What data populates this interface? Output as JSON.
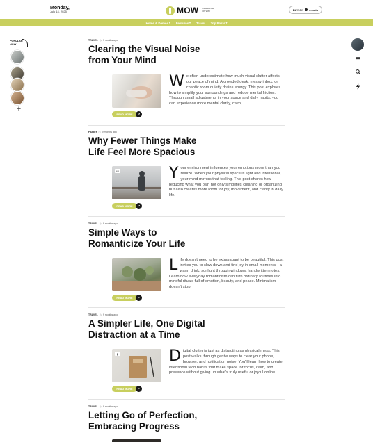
{
  "header": {
    "day": "Monday,",
    "date": "July 14, 2025",
    "logo": "MOW",
    "logo_tagline": "MINIMALISM ON WAY",
    "buy_label": "BUY ON",
    "buy_brand": "envato"
  },
  "nav": [
    {
      "label": "Home & Demos",
      "dropdown": true
    },
    {
      "label": "Features",
      "dropdown": true
    },
    {
      "label": "Travel",
      "dropdown": false
    },
    {
      "label": "Top Posts",
      "dropdown": true
    }
  ],
  "popular": {
    "title_line1": "POPULAR",
    "title_line2": "NOW",
    "add_symbol": "+"
  },
  "articles": [
    {
      "category": "TRAVEL",
      "time": "9 months ago",
      "title": "Clearing the Visual Noise from Your Mind",
      "dropcap": "W",
      "excerpt": "e often underestimate how much visual clutter affects our peace of mind. A crowded desk, messy inbox, or chaotic room quietly drains energy. This post explores how to simplify your surroundings and reduce mental friction. Through small adjustments in your space and daily habits, you can experience more mental clarity, calm,",
      "read_more": "READ MORE",
      "badge": ""
    },
    {
      "category": "FAMILY",
      "time": "9 months ago",
      "title": "Why Fewer Things Make Life Feel More Spacious",
      "dropcap": "Y",
      "excerpt": "our environment influences your emotions more than you realize. When your physical space is light and intentional, your mind mirrors that feeling. This post shares how reducing what you own not only simplifies cleaning or organizing but also creates more room for joy, movement, and clarity in daily life.",
      "read_more": "READ MORE",
      "badge": "66"
    },
    {
      "category": "TRAVEL",
      "time": "9 months ago",
      "title": "Simple Ways to Romanticize Your Life",
      "dropcap": "L",
      "excerpt": "ife doesn't need to be extravagant to be beautiful. This post invites you to slow down and find joy in small moments—a warm drink, sunlight through windows, handwritten notes. Learn how everyday romanticism can turn ordinary routines into mindful rituals full of emotion, beauty, and peace. Minimalism doesn't stop",
      "read_more": "READ MORE",
      "badge": ""
    },
    {
      "category": "TRAVEL",
      "time": "9 months ago",
      "title": "A Simpler Life, One Digital Distraction at a Time",
      "dropcap": "D",
      "excerpt": "igital clutter is just as distracting as physical mess. This post walks through gentle ways to clear your phone, browser, and notification noise. You'll learn how to create intentional tech habits that make space for focus, calm, and presence without giving up what's truly useful or joyful online.",
      "read_more": "READ MORE",
      "badge": "▮"
    },
    {
      "category": "TRAVEL",
      "time": "9 months ago",
      "title": "Letting Go of Perfection, Embracing Progress"
    }
  ],
  "colors": {
    "accent": "#c8cf5e",
    "text": "#111111",
    "muted": "#444444"
  }
}
